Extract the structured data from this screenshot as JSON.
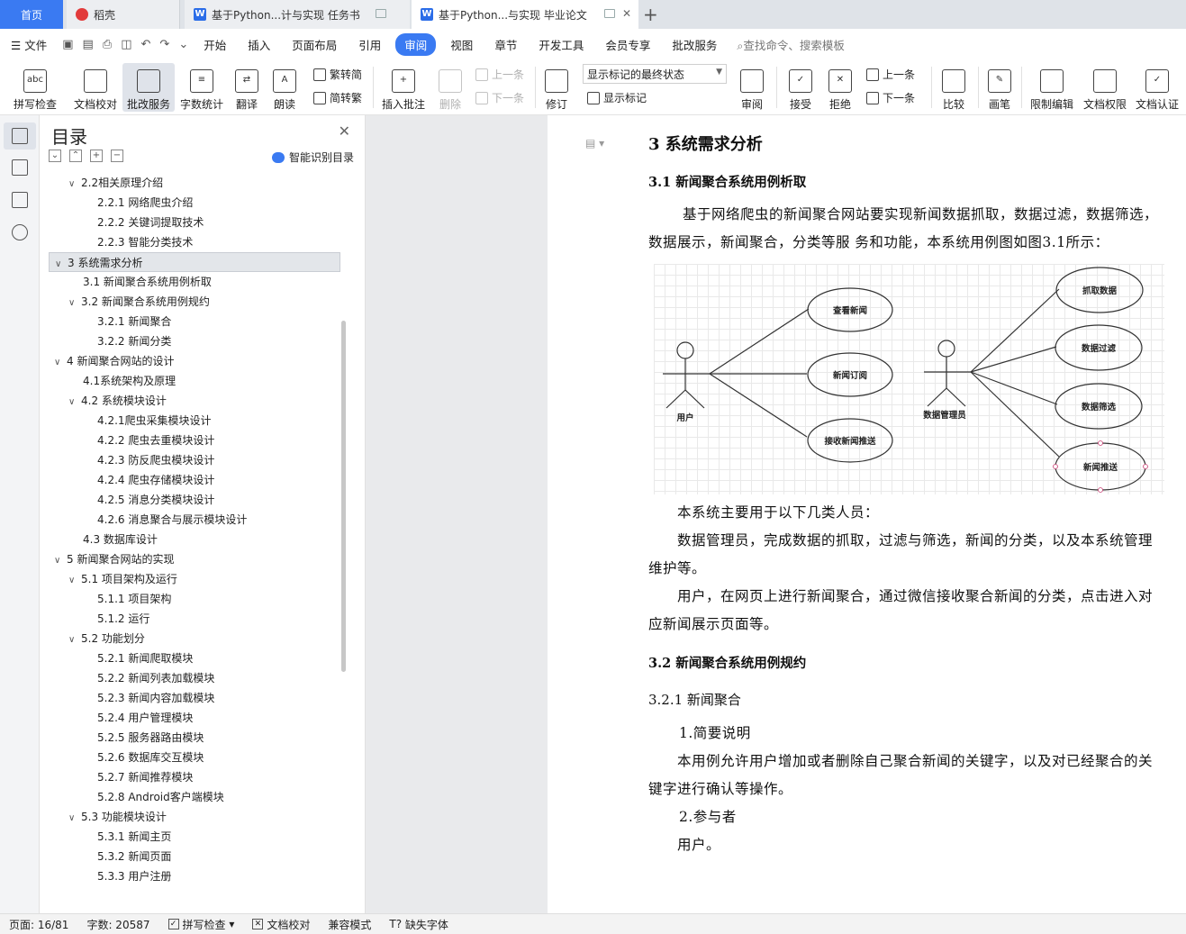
{
  "tabs": {
    "home": "首页",
    "daoke": "稻壳",
    "doc1": "基于Python...计与实现 任务书",
    "doc2": "基于Python...与实现 毕业论文"
  },
  "menu": {
    "file": "文件",
    "items": [
      "开始",
      "插入",
      "页面布局",
      "引用",
      "审阅",
      "视图",
      "章节",
      "开发工具",
      "会员专享",
      "批改服务"
    ],
    "active": "审阅",
    "search_placeholder": "查找命令、搜索模板"
  },
  "ribbon": {
    "spell_check": "拼写检查",
    "doc_proof": "文档校对",
    "correct_service": "批改服务",
    "word_count": "字数统计",
    "translate": "翻译",
    "read_aloud": "朗读",
    "trad_to_simp": "繁转简",
    "simp_to_trad": "简转繁",
    "insert_comment": "插入批注",
    "delete": "删除",
    "prev_comment": "上一条",
    "next_comment": "下一条",
    "revise": "修订",
    "markup_state": "显示标记的最终状态",
    "show_markup": "显示标记",
    "review": "审阅",
    "accept": "接受",
    "reject": "拒绝",
    "prev_change": "上一条",
    "next_change": "下一条",
    "compare": "比较",
    "pen": "画笔",
    "restrict_edit": "限制编辑",
    "doc_permission": "文档权限",
    "doc_cert": "文档认证"
  },
  "toc": {
    "title": "目录",
    "smart_label": "智能识别目录",
    "items": [
      {
        "level": 1,
        "label": "2.2相关原理介绍",
        "chev": "∨"
      },
      {
        "level": 2,
        "label": "2.2.1 网络爬虫介绍",
        "chev": ""
      },
      {
        "level": 2,
        "label": "2.2.2 关键词提取技术",
        "chev": ""
      },
      {
        "level": 2,
        "label": "2.2.3 智能分类技术",
        "chev": ""
      },
      {
        "level": 0,
        "label": "3 系统需求分析",
        "chev": "∨",
        "selected": true
      },
      {
        "level": 1,
        "label": "3.1 新闻聚合系统用例析取",
        "chev": ""
      },
      {
        "level": 1,
        "label": "3.2 新闻聚合系统用例规约",
        "chev": "∨"
      },
      {
        "level": 2,
        "label": "3.2.1 新闻聚合",
        "chev": ""
      },
      {
        "level": 2,
        "label": "3.2.2 新闻分类",
        "chev": ""
      },
      {
        "level": 0,
        "label": "4 新闻聚合网站的设计",
        "chev": "∨"
      },
      {
        "level": 1,
        "label": "4.1系统架构及原理",
        "chev": ""
      },
      {
        "level": 1,
        "label": "4.2 系统模块设计",
        "chev": "∨"
      },
      {
        "level": 2,
        "label": "4.2.1爬虫采集模块设计",
        "chev": ""
      },
      {
        "level": 2,
        "label": "4.2.2 爬虫去重模块设计",
        "chev": ""
      },
      {
        "level": 2,
        "label": "4.2.3 防反爬虫模块设计",
        "chev": ""
      },
      {
        "level": 2,
        "label": "4.2.4 爬虫存储模块设计",
        "chev": ""
      },
      {
        "level": 2,
        "label": "4.2.5 消息分类模块设计",
        "chev": ""
      },
      {
        "level": 2,
        "label": "4.2.6 消息聚合与展示模块设计",
        "chev": ""
      },
      {
        "level": 1,
        "label": "4.3 数据库设计",
        "chev": ""
      },
      {
        "level": 0,
        "label": "5 新闻聚合网站的实现",
        "chev": "∨"
      },
      {
        "level": 1,
        "label": "5.1 项目架构及运行",
        "chev": "∨"
      },
      {
        "level": 2,
        "label": "5.1.1 项目架构",
        "chev": ""
      },
      {
        "level": 2,
        "label": "5.1.2 运行",
        "chev": ""
      },
      {
        "level": 1,
        "label": "5.2 功能划分",
        "chev": "∨"
      },
      {
        "level": 2,
        "label": "5.2.1 新闻爬取模块",
        "chev": ""
      },
      {
        "level": 2,
        "label": "5.2.2 新闻列表加载模块",
        "chev": ""
      },
      {
        "level": 2,
        "label": "5.2.3 新闻内容加载模块",
        "chev": ""
      },
      {
        "level": 2,
        "label": "5.2.4 用户管理模块",
        "chev": ""
      },
      {
        "level": 2,
        "label": "5.2.5 服务器路由模块",
        "chev": ""
      },
      {
        "level": 2,
        "label": "5.2.6 数据库交互模块",
        "chev": ""
      },
      {
        "level": 2,
        "label": "5.2.7 新闻推荐模块",
        "chev": ""
      },
      {
        "level": 2,
        "label": "5.2.8 Android客户端模块",
        "chev": ""
      },
      {
        "level": 1,
        "label": "5.3 功能模块设计",
        "chev": "∨"
      },
      {
        "level": 2,
        "label": "5.3.1 新闻主页",
        "chev": ""
      },
      {
        "level": 2,
        "label": "5.3.2 新闻页面",
        "chev": ""
      },
      {
        "level": 2,
        "label": "5.3.3 用户注册",
        "chev": ""
      }
    ]
  },
  "document": {
    "h1": "3 系统需求分析",
    "h2_1": "3.1 新闻聚合系统用例析取",
    "p1": "基于网络爬虫的新闻聚合网站要实现新闻数据抓取，数据过滤，数据筛选，数据展示，新闻聚合，分类等服 务和功能，本系统用例图如图3.1所示：",
    "diagram": {
      "actor_user": "用户",
      "actor_admin": "数据管理员",
      "user_cases": [
        "查看新闻",
        "新闻订阅",
        "接收新闻推送"
      ],
      "admin_cases": [
        "抓取数据",
        "数据过滤",
        "数据筛选",
        "新闻推送"
      ]
    },
    "p2": "本系统主要用于以下几类人员：",
    "p3": "数据管理员，完成数据的抓取，过滤与筛选，新闻的分类，以及本系统管理维护等。",
    "p4": "用户，在网页上进行新闻聚合，通过微信接收聚合新闻的分类，点击进入对应新闻展示页面等。",
    "h2_2": "3.2 新闻聚合系统用例规约",
    "h3_1": "3.2.1 新闻聚合",
    "p5": "1.简要说明",
    "p6": "本用例允许用户增加或者删除自己聚合新闻的关键字，以及对已经聚合的关键字进行确认等操作。",
    "p7": "2.参与者",
    "p8": "用户。"
  },
  "status": {
    "page": "页面: 16/81",
    "words": "字数: 20587",
    "spell": "拼写检查",
    "proof": "文档校对",
    "compat": "兼容模式",
    "missing_font": "缺失字体"
  }
}
